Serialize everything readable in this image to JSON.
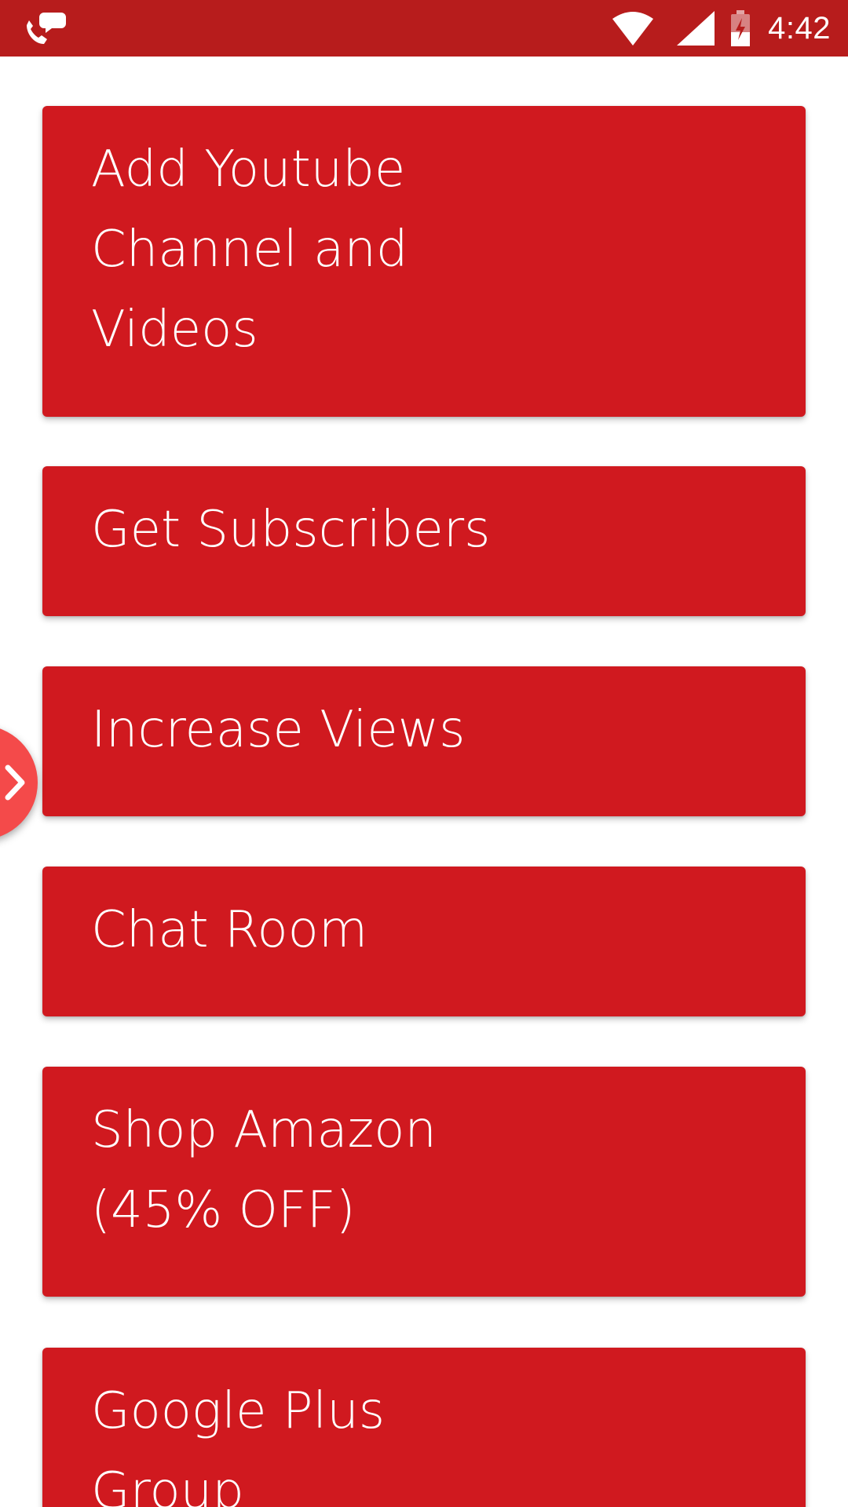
{
  "status_bar": {
    "time": "4:42",
    "background": "#b71c1c",
    "icons": [
      "call-notification-icon",
      "wifi-icon",
      "cell-signal-icon",
      "battery-charging-icon"
    ]
  },
  "menu": {
    "card_color": "#d0191f",
    "items": [
      {
        "label": "Add Youtube Channel and Videos"
      },
      {
        "label": "Get Subscribers"
      },
      {
        "label": "Increase Views"
      },
      {
        "label": "Chat Room"
      },
      {
        "label": "Shop Amazon (45% OFF)"
      },
      {
        "label": "Google Plus Group"
      }
    ]
  },
  "side_tab": {
    "icon": "chevron-right-icon",
    "color": "#f44a4a"
  }
}
